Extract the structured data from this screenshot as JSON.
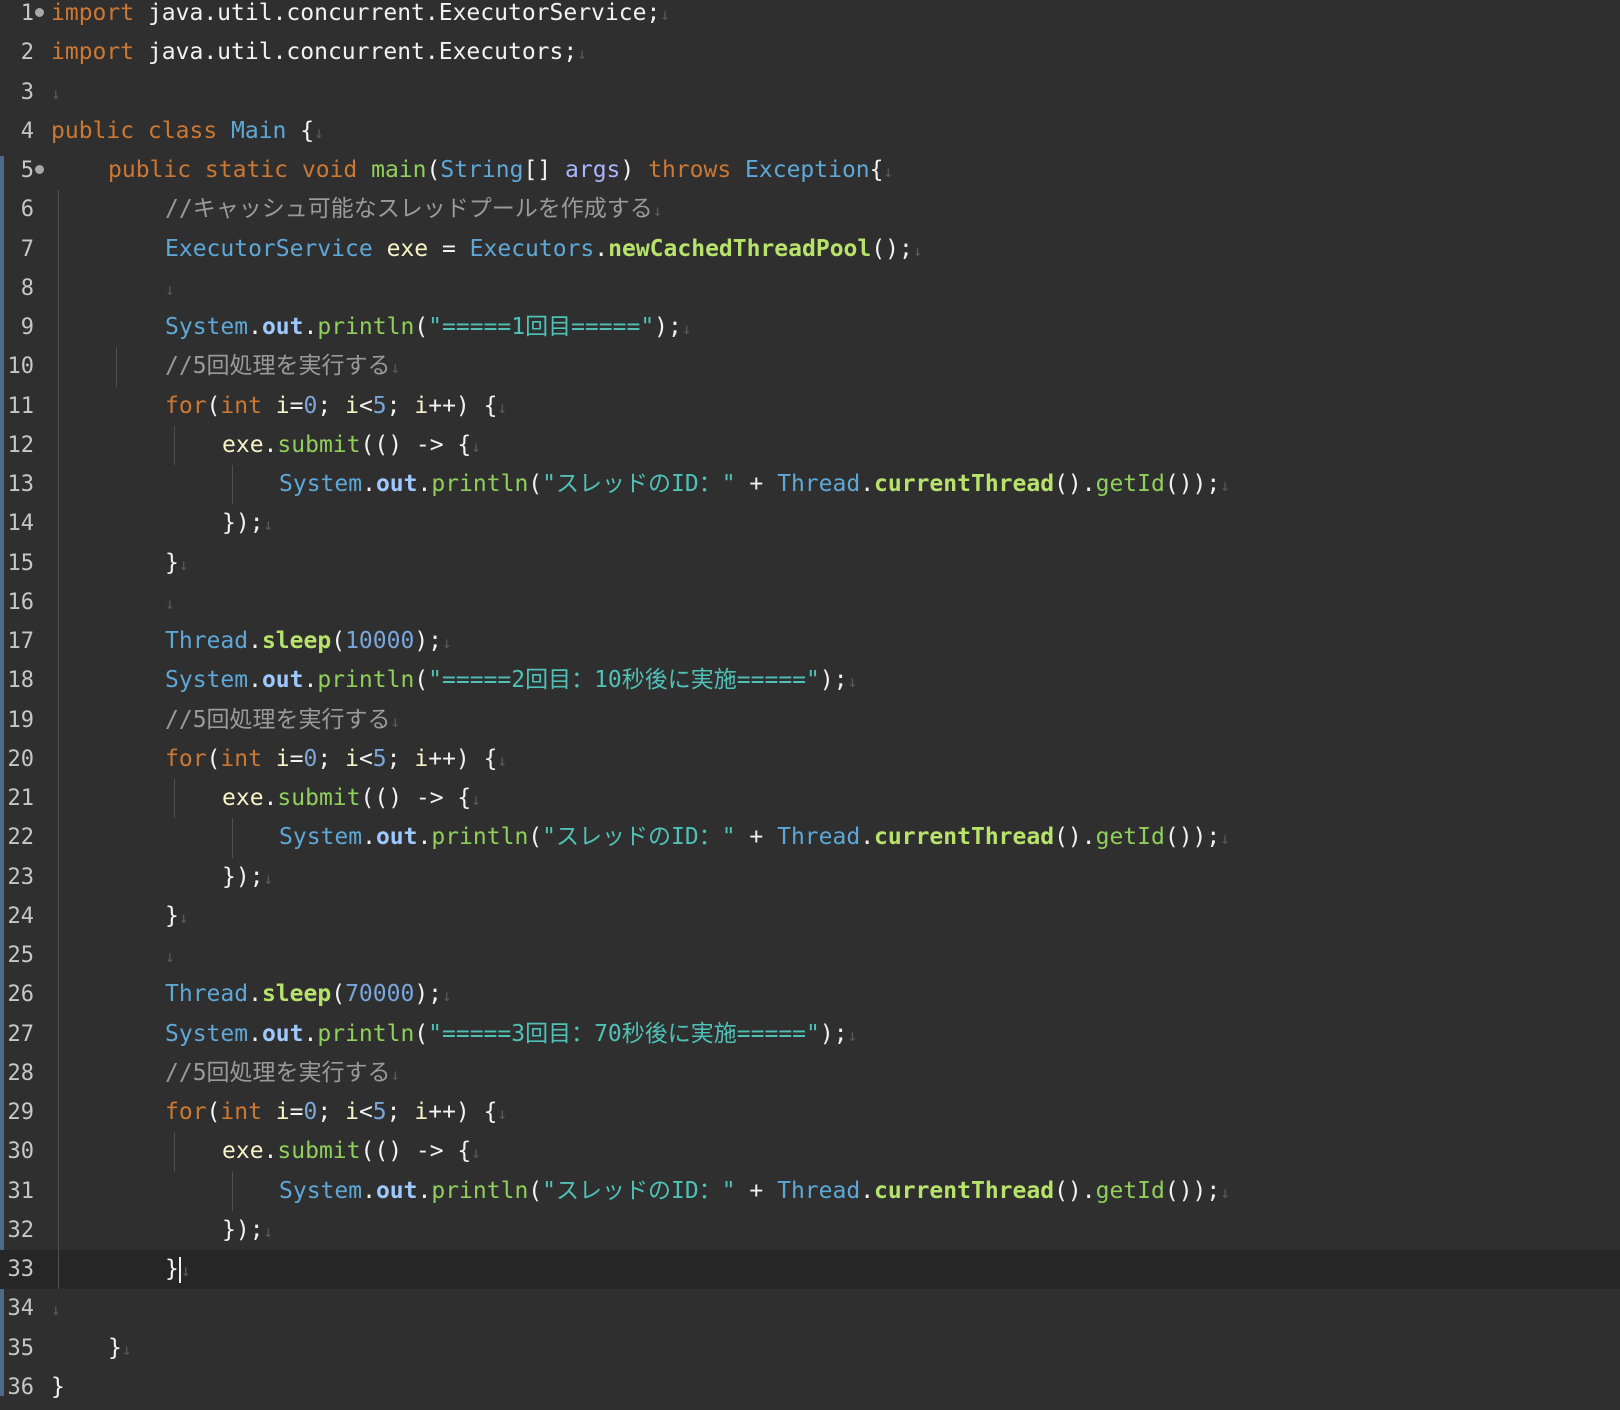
{
  "editor": {
    "language": "java",
    "current_line": 33,
    "newline_glyph": "↓",
    "colors": {
      "background": "#2f2f2f",
      "current_line": "#262626",
      "keyword": "#cc7832",
      "type": "#5ea8d8",
      "string": "#4fc1b6",
      "number": "#7aa6da",
      "comment": "#9a9a9a",
      "method": "#8fcf5a"
    },
    "lines": [
      {
        "n": "1",
        "fold": true,
        "indent": 0,
        "tokens": [
          [
            "kw-import",
            "import"
          ],
          [
            "plain",
            " java.util.concurrent.ExecutorService;"
          ]
        ],
        "nl": true
      },
      {
        "n": "2",
        "indent": 0,
        "tokens": [
          [
            "kw-import",
            "import"
          ],
          [
            "plain",
            " java.util.concurrent.Executors;"
          ]
        ],
        "nl": true
      },
      {
        "n": "3",
        "indent": 0,
        "tokens": [],
        "nl": true
      },
      {
        "n": "4",
        "indent": 0,
        "tokens": [
          [
            "kw",
            "public class "
          ],
          [
            "type",
            "Main"
          ],
          [
            "plain",
            " {"
          ]
        ],
        "nl": true
      },
      {
        "n": "5",
        "fold": true,
        "indent": 1,
        "tokens": [
          [
            "kw",
            "public static void "
          ],
          [
            "method",
            "main"
          ],
          [
            "plain",
            "("
          ],
          [
            "type",
            "String"
          ],
          [
            "plain",
            "[] "
          ],
          [
            "param",
            "args"
          ],
          [
            "plain",
            ") "
          ],
          [
            "kw",
            "throws "
          ],
          [
            "type",
            "Exception"
          ],
          [
            "plain",
            "{"
          ]
        ],
        "nl": true
      },
      {
        "n": "6",
        "indent": 2,
        "guides": [
          1
        ],
        "tokens": [
          [
            "cmt",
            "//キャッシュ可能なスレッドプールを作成する"
          ]
        ],
        "nl": true
      },
      {
        "n": "7",
        "indent": 2,
        "guides": [
          1
        ],
        "tokens": [
          [
            "type",
            "ExecutorService "
          ],
          [
            "ident",
            "exe"
          ],
          [
            "plain",
            " = "
          ],
          [
            "type",
            "Executors"
          ],
          [
            "plain",
            "."
          ],
          [
            "method-bold",
            "newCachedThreadPool"
          ],
          [
            "plain",
            "();"
          ]
        ],
        "nl": true
      },
      {
        "n": "8",
        "indent": 2,
        "guides": [
          1
        ],
        "tokens": [],
        "nl": true
      },
      {
        "n": "9",
        "indent": 2,
        "guides": [
          1
        ],
        "tokens": [
          [
            "type",
            "System"
          ],
          [
            "plain",
            "."
          ],
          [
            "field",
            "out"
          ],
          [
            "plain",
            "."
          ],
          [
            "method",
            "println"
          ],
          [
            "plain",
            "("
          ],
          [
            "str",
            "\"=====1回目=====\""
          ],
          [
            "plain",
            ");"
          ]
        ],
        "nl": true
      },
      {
        "n": "10",
        "indent": 2,
        "guides": [
          1,
          2
        ],
        "tokens": [
          [
            "cmt",
            "//5回処理を実行する"
          ]
        ],
        "nl": true
      },
      {
        "n": "11",
        "indent": 2,
        "guides": [
          1
        ],
        "tokens": [
          [
            "kw",
            "for"
          ],
          [
            "plain",
            "("
          ],
          [
            "kw",
            "int "
          ],
          [
            "ident",
            "i"
          ],
          [
            "plain",
            "="
          ],
          [
            "num",
            "0"
          ],
          [
            "plain",
            "; "
          ],
          [
            "ident",
            "i"
          ],
          [
            "plain",
            "<"
          ],
          [
            "num",
            "5"
          ],
          [
            "plain",
            "; "
          ],
          [
            "ident",
            "i"
          ],
          [
            "plain",
            "++) {"
          ]
        ],
        "nl": true
      },
      {
        "n": "12",
        "indent": 3,
        "guides": [
          1,
          3
        ],
        "tokens": [
          [
            "ident",
            "exe"
          ],
          [
            "plain",
            "."
          ],
          [
            "method",
            "submit"
          ],
          [
            "plain",
            "(() -> {"
          ]
        ],
        "nl": true
      },
      {
        "n": "13",
        "indent": 4,
        "guides": [
          1,
          4
        ],
        "tokens": [
          [
            "type",
            "System"
          ],
          [
            "plain",
            "."
          ],
          [
            "field",
            "out"
          ],
          [
            "plain",
            "."
          ],
          [
            "method",
            "println"
          ],
          [
            "plain",
            "("
          ],
          [
            "str",
            "\"スレッドのID：\""
          ],
          [
            "plain",
            " + "
          ],
          [
            "type",
            "Thread"
          ],
          [
            "plain",
            "."
          ],
          [
            "method-bold",
            "currentThread"
          ],
          [
            "plain",
            "()."
          ],
          [
            "method",
            "getId"
          ],
          [
            "plain",
            "());"
          ]
        ],
        "nl": true
      },
      {
        "n": "14",
        "indent": 3,
        "guides": [
          1
        ],
        "tokens": [
          [
            "plain",
            "});"
          ]
        ],
        "nl": true
      },
      {
        "n": "15",
        "indent": 2,
        "guides": [
          1
        ],
        "tokens": [
          [
            "plain",
            "}"
          ]
        ],
        "nl": true
      },
      {
        "n": "16",
        "indent": 2,
        "guides": [
          1
        ],
        "tokens": [],
        "nl": true
      },
      {
        "n": "17",
        "indent": 2,
        "guides": [
          1
        ],
        "tokens": [
          [
            "type",
            "Thread"
          ],
          [
            "plain",
            "."
          ],
          [
            "method-bold",
            "sleep"
          ],
          [
            "plain",
            "("
          ],
          [
            "num",
            "10000"
          ],
          [
            "plain",
            ");"
          ]
        ],
        "nl": true
      },
      {
        "n": "18",
        "indent": 2,
        "guides": [
          1
        ],
        "tokens": [
          [
            "type",
            "System"
          ],
          [
            "plain",
            "."
          ],
          [
            "field",
            "out"
          ],
          [
            "plain",
            "."
          ],
          [
            "method",
            "println"
          ],
          [
            "plain",
            "("
          ],
          [
            "str",
            "\"=====2回目：10秒後に実施=====\""
          ],
          [
            "plain",
            ");"
          ]
        ],
        "nl": true
      },
      {
        "n": "19",
        "indent": 2,
        "guides": [
          1
        ],
        "tokens": [
          [
            "cmt",
            "//5回処理を実行する"
          ]
        ],
        "nl": true
      },
      {
        "n": "20",
        "indent": 2,
        "guides": [
          1
        ],
        "tokens": [
          [
            "kw",
            "for"
          ],
          [
            "plain",
            "("
          ],
          [
            "kw",
            "int "
          ],
          [
            "ident",
            "i"
          ],
          [
            "plain",
            "="
          ],
          [
            "num",
            "0"
          ],
          [
            "plain",
            "; "
          ],
          [
            "ident",
            "i"
          ],
          [
            "plain",
            "<"
          ],
          [
            "num",
            "5"
          ],
          [
            "plain",
            "; "
          ],
          [
            "ident",
            "i"
          ],
          [
            "plain",
            "++) {"
          ]
        ],
        "nl": true
      },
      {
        "n": "21",
        "indent": 3,
        "guides": [
          1,
          3
        ],
        "tokens": [
          [
            "ident",
            "exe"
          ],
          [
            "plain",
            "."
          ],
          [
            "method",
            "submit"
          ],
          [
            "plain",
            "(() -> {"
          ]
        ],
        "nl": true
      },
      {
        "n": "22",
        "indent": 4,
        "guides": [
          1,
          4
        ],
        "tokens": [
          [
            "type",
            "System"
          ],
          [
            "plain",
            "."
          ],
          [
            "field",
            "out"
          ],
          [
            "plain",
            "."
          ],
          [
            "method",
            "println"
          ],
          [
            "plain",
            "("
          ],
          [
            "str",
            "\"スレッドのID：\""
          ],
          [
            "plain",
            " + "
          ],
          [
            "type",
            "Thread"
          ],
          [
            "plain",
            "."
          ],
          [
            "method-bold",
            "currentThread"
          ],
          [
            "plain",
            "()."
          ],
          [
            "method",
            "getId"
          ],
          [
            "plain",
            "());"
          ]
        ],
        "nl": true
      },
      {
        "n": "23",
        "indent": 3,
        "guides": [
          1
        ],
        "tokens": [
          [
            "plain",
            "});"
          ]
        ],
        "nl": true
      },
      {
        "n": "24",
        "indent": 2,
        "guides": [
          1
        ],
        "tokens": [
          [
            "plain",
            "}"
          ]
        ],
        "nl": true
      },
      {
        "n": "25",
        "indent": 2,
        "guides": [
          1
        ],
        "tokens": [],
        "nl": true
      },
      {
        "n": "26",
        "indent": 2,
        "guides": [
          1
        ],
        "tokens": [
          [
            "type",
            "Thread"
          ],
          [
            "plain",
            "."
          ],
          [
            "method-bold",
            "sleep"
          ],
          [
            "plain",
            "("
          ],
          [
            "num",
            "70000"
          ],
          [
            "plain",
            ");"
          ]
        ],
        "nl": true
      },
      {
        "n": "27",
        "indent": 2,
        "guides": [
          1
        ],
        "tokens": [
          [
            "type",
            "System"
          ],
          [
            "plain",
            "."
          ],
          [
            "field",
            "out"
          ],
          [
            "plain",
            "."
          ],
          [
            "method",
            "println"
          ],
          [
            "plain",
            "("
          ],
          [
            "str",
            "\"=====3回目：70秒後に実施=====\""
          ],
          [
            "plain",
            ");"
          ]
        ],
        "nl": true
      },
      {
        "n": "28",
        "indent": 2,
        "guides": [
          1
        ],
        "tokens": [
          [
            "cmt",
            "//5回処理を実行する"
          ]
        ],
        "nl": true
      },
      {
        "n": "29",
        "indent": 2,
        "guides": [
          1
        ],
        "tokens": [
          [
            "kw",
            "for"
          ],
          [
            "plain",
            "("
          ],
          [
            "kw",
            "int "
          ],
          [
            "ident",
            "i"
          ],
          [
            "plain",
            "="
          ],
          [
            "num",
            "0"
          ],
          [
            "plain",
            "; "
          ],
          [
            "ident",
            "i"
          ],
          [
            "plain",
            "<"
          ],
          [
            "num",
            "5"
          ],
          [
            "plain",
            "; "
          ],
          [
            "ident",
            "i"
          ],
          [
            "plain",
            "++) {"
          ]
        ],
        "nl": true
      },
      {
        "n": "30",
        "indent": 3,
        "guides": [
          1,
          3
        ],
        "tokens": [
          [
            "ident",
            "exe"
          ],
          [
            "plain",
            "."
          ],
          [
            "method",
            "submit"
          ],
          [
            "plain",
            "(() -> {"
          ]
        ],
        "nl": true
      },
      {
        "n": "31",
        "indent": 4,
        "guides": [
          1,
          4
        ],
        "tokens": [
          [
            "type",
            "System"
          ],
          [
            "plain",
            "."
          ],
          [
            "field",
            "out"
          ],
          [
            "plain",
            "."
          ],
          [
            "method",
            "println"
          ],
          [
            "plain",
            "("
          ],
          [
            "str",
            "\"スレッドのID：\""
          ],
          [
            "plain",
            " + "
          ],
          [
            "type",
            "Thread"
          ],
          [
            "plain",
            "."
          ],
          [
            "method-bold",
            "currentThread"
          ],
          [
            "plain",
            "()."
          ],
          [
            "method",
            "getId"
          ],
          [
            "plain",
            "());"
          ]
        ],
        "nl": true
      },
      {
        "n": "32",
        "indent": 3,
        "guides": [
          1
        ],
        "tokens": [
          [
            "plain",
            "});"
          ]
        ],
        "nl": true
      },
      {
        "n": "33",
        "indent": 2,
        "guides": [
          1
        ],
        "caret": true,
        "tokens": [
          [
            "plain",
            "}"
          ]
        ],
        "nl": true
      },
      {
        "n": "34",
        "indent": 0,
        "tokens": [],
        "nl": true
      },
      {
        "n": "35",
        "indent": 1,
        "tokens": [
          [
            "plain",
            "}"
          ]
        ],
        "nl": true
      },
      {
        "n": "36",
        "indent": 0,
        "tokens": [
          [
            "plain",
            "}"
          ]
        ],
        "nl": false
      }
    ]
  }
}
